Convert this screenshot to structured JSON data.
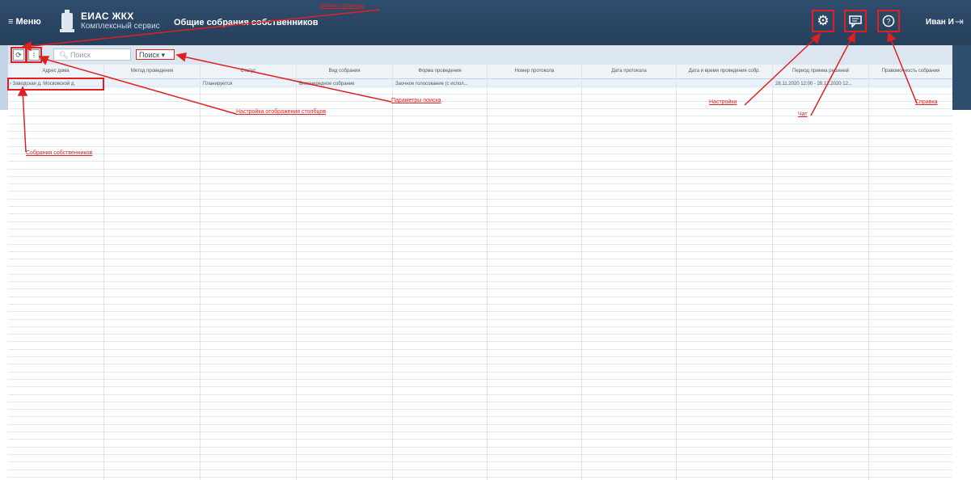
{
  "header": {
    "menu_label": "≡ Меню",
    "app_title": "ЕИАС ЖКХ",
    "app_subtitle": "Комплексный сервис",
    "page_title": "Общие собрания собственников",
    "user_name": "Иван И",
    "icons": [
      "gear-icon",
      "chat-icon",
      "help-icon",
      "logout-icon"
    ]
  },
  "toolbar": {
    "search_placeholder": "Поиск",
    "find_label": "Поиск ▾"
  },
  "table": {
    "columns": [
      "Адрес дома",
      "Метод проведения",
      "Статус",
      "Вид собрания",
      "Форма проведения",
      "Номер протокола",
      "Дата протокола",
      "Дата и время проведения собр.",
      "Период приема решений",
      "Правомочность собрания"
    ],
    "rows": [
      [
        "› Заводская д. Московской д.",
        "",
        "Планируется",
        "Внеочередное собрание",
        "Заочное голосование (с испол...",
        "",
        "",
        "",
        "28.11.2020 12:00 - 28.12.2020 12...",
        ""
      ]
    ]
  },
  "annotations": {
    "header_label": "Шапка страницы",
    "column_settings": "Настройка отображения столбцов",
    "search_params": "Параметры поиска",
    "settings": "Настройки",
    "chat": "Чат",
    "help": "Справка",
    "owners_meetings": "Собрания собственников"
  },
  "colors": {
    "header_bg": "#2f4d6d",
    "annotation_red": "#e02020",
    "band": "#c4d4e6"
  }
}
